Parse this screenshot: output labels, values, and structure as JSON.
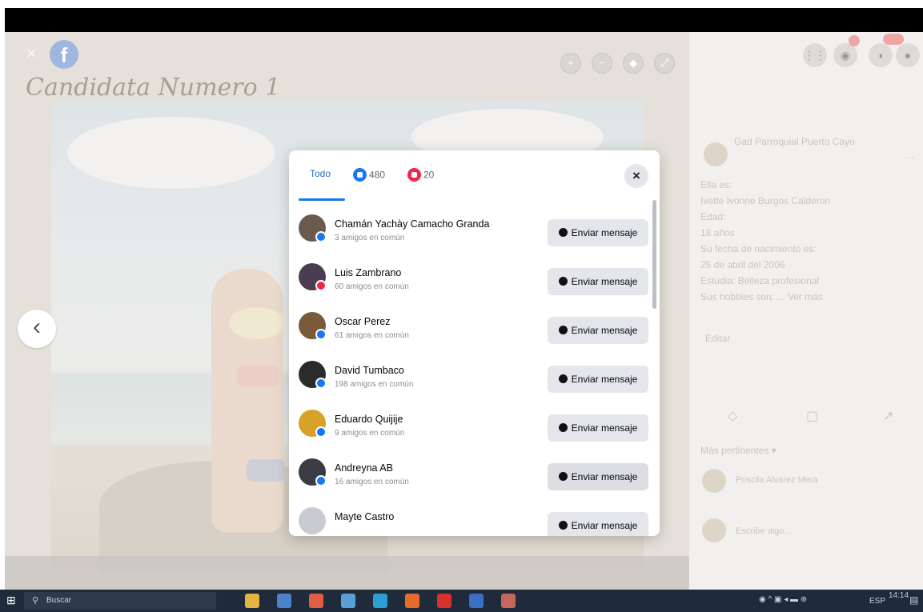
{
  "photo_viewer": {
    "caption": "Candidata Numero 1",
    "close_icon": "close-icon",
    "logo_icon": "facebook-logo-icon",
    "prev_icon": "chevron-left-icon",
    "next_icon": "chevron-right-icon",
    "prev_glyph": "‹",
    "next_glyph": "›",
    "close_glyph": "×",
    "logo_glyph": "f"
  },
  "reactions_dialog": {
    "tab_all_label": "Todo",
    "like_count": "480",
    "love_count": "20",
    "close_glyph": "×",
    "people": [
      {
        "name": "Chamán Yachày Camacho Granda",
        "mutual": "3 amigos en común",
        "button": "Enviar mensaje",
        "reaction": "like",
        "avatar_color": "#6b5b4e"
      },
      {
        "name": "Luis Zambrano",
        "mutual": "60 amigos en común",
        "button": "Enviar mensaje",
        "reaction": "love",
        "avatar_color": "#4a3d52"
      },
      {
        "name": "Oscar Perez",
        "mutual": "61 amigos en común",
        "button": "Enviar mensaje",
        "reaction": "like",
        "avatar_color": "#7a5a3a"
      },
      {
        "name": "David Tumbaco",
        "mutual": "198 amigos en común",
        "button": "Enviar mensaje",
        "reaction": "like",
        "avatar_color": "#2b2b2b"
      },
      {
        "name": "Eduardo Quijije",
        "mutual": "9 amigos en común",
        "button": "Enviar mensaje",
        "reaction": "like",
        "avatar_color": "#d8a12a"
      },
      {
        "name": "Andreyna AB",
        "mutual": "16 amigos en común",
        "button": "Enviar mensaje",
        "reaction": "like",
        "avatar_color": "#3b3b44"
      },
      {
        "name": "Mayte Castro",
        "mutual": "",
        "button": "Enviar mensaje",
        "reaction": "like",
        "avatar_color": "#c8ccd2"
      }
    ]
  },
  "sidebar": {
    "page_name": "Gad Parroquial Puerto Cayo",
    "more_glyph": "···",
    "body_lines": [
      "Ella es:",
      "Ivette Ivonne Burgos Calderon",
      "Edad:",
      "18 años",
      "Su fecha de nacimiento es:",
      "25 de abril del 2006",
      "Estudia: Belleza profesional",
      "Sus hobbies son: ... Ver más"
    ],
    "edit_label": "Editar",
    "comment_label": "Más pertinentes ▾",
    "commenter_name": "Priscila Alvarez Mera",
    "comment_placeholder": "Escribe algo..."
  },
  "taskbar": {
    "search_label": "Buscar",
    "lang": "ESP",
    "time": "14:14",
    "start_icon": "windows-start-icon",
    "search_icon": "search-icon"
  },
  "colors": {
    "facebook_blue": "#1877f2",
    "love_red": "#f02849",
    "button_gray": "#e4e6eb"
  }
}
